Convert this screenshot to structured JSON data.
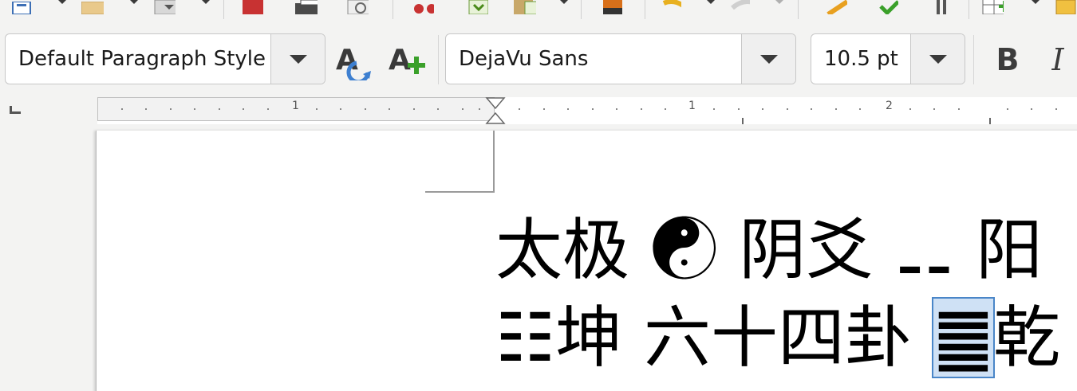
{
  "paragraph_style": {
    "value": "Default Paragraph Style"
  },
  "font_name": {
    "value": "DejaVu Sans"
  },
  "font_size": {
    "value": "10.5 pt"
  },
  "format": {
    "bold_label": "B",
    "italic_label": "I"
  },
  "ruler": {
    "labels": [
      "1",
      "1",
      "2"
    ]
  },
  "document": {
    "line1": "太极 ☯ 阴爻 ⚋ 阳",
    "line2_before": "☷坤 六十四卦 ",
    "line2_selected": "䷀",
    "line2_after": "乾"
  },
  "colors": {
    "selection": "#cfe1f5",
    "selection_border": "#4a86c8"
  }
}
